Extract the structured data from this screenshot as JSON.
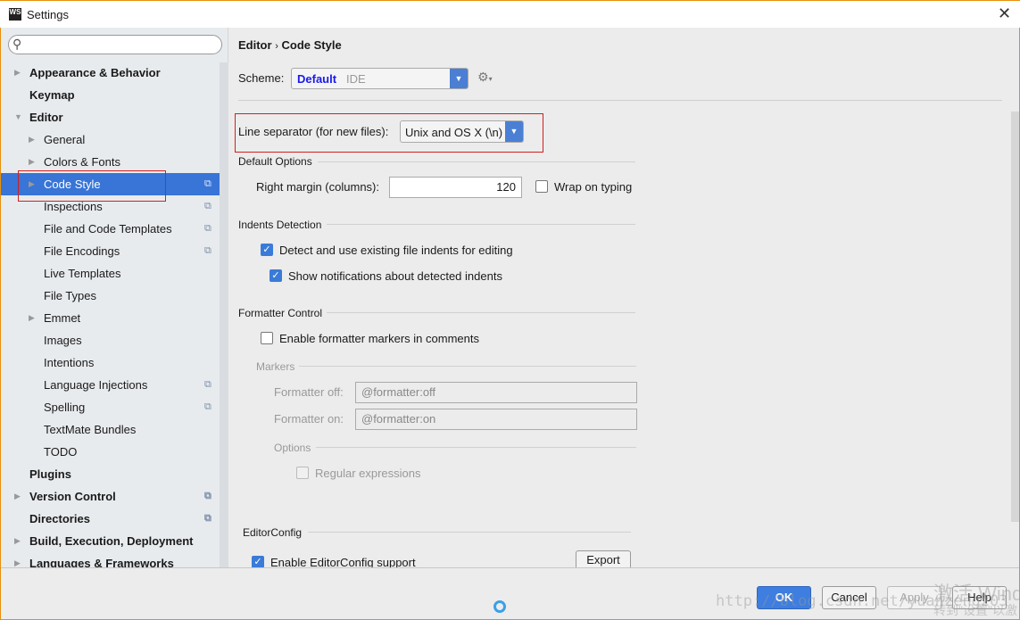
{
  "window": {
    "title": "Settings",
    "logo": "WS"
  },
  "search": {
    "placeholder": ""
  },
  "tree": [
    {
      "label": "Appearance & Behavior",
      "bold": true,
      "level": 0,
      "arrow": "right",
      "copy": false
    },
    {
      "label": "Keymap",
      "bold": true,
      "level": 0,
      "arrow": "",
      "copy": false
    },
    {
      "label": "Editor",
      "bold": true,
      "level": 0,
      "arrow": "down",
      "copy": false
    },
    {
      "label": "General",
      "bold": false,
      "level": 1,
      "arrow": "right",
      "copy": false
    },
    {
      "label": "Colors & Fonts",
      "bold": false,
      "level": 1,
      "arrow": "right",
      "copy": false
    },
    {
      "label": "Code Style",
      "bold": false,
      "level": 1,
      "arrow": "right",
      "copy": true,
      "selected": true
    },
    {
      "label": "Inspections",
      "bold": false,
      "level": 1,
      "arrow": "",
      "copy": true
    },
    {
      "label": "File and Code Templates",
      "bold": false,
      "level": 1,
      "arrow": "",
      "copy": true
    },
    {
      "label": "File Encodings",
      "bold": false,
      "level": 1,
      "arrow": "",
      "copy": true
    },
    {
      "label": "Live Templates",
      "bold": false,
      "level": 1,
      "arrow": "",
      "copy": false
    },
    {
      "label": "File Types",
      "bold": false,
      "level": 1,
      "arrow": "",
      "copy": false
    },
    {
      "label": "Emmet",
      "bold": false,
      "level": 1,
      "arrow": "right",
      "copy": false
    },
    {
      "label": "Images",
      "bold": false,
      "level": 1,
      "arrow": "",
      "copy": false
    },
    {
      "label": "Intentions",
      "bold": false,
      "level": 1,
      "arrow": "",
      "copy": false
    },
    {
      "label": "Language Injections",
      "bold": false,
      "level": 1,
      "arrow": "",
      "copy": true
    },
    {
      "label": "Spelling",
      "bold": false,
      "level": 1,
      "arrow": "",
      "copy": true
    },
    {
      "label": "TextMate Bundles",
      "bold": false,
      "level": 1,
      "arrow": "",
      "copy": false
    },
    {
      "label": "TODO",
      "bold": false,
      "level": 1,
      "arrow": "",
      "copy": false
    },
    {
      "label": "Plugins",
      "bold": true,
      "level": 0,
      "arrow": "",
      "copy": false
    },
    {
      "label": "Version Control",
      "bold": true,
      "level": 0,
      "arrow": "right",
      "copy": true
    },
    {
      "label": "Directories",
      "bold": true,
      "level": 0,
      "arrow": "",
      "copy": true
    },
    {
      "label": "Build, Execution, Deployment",
      "bold": true,
      "level": 0,
      "arrow": "right",
      "copy": false
    },
    {
      "label": "Languages & Frameworks",
      "bold": true,
      "level": 0,
      "arrow": "right",
      "copy": false
    }
  ],
  "breadcrumb": {
    "parent": "Editor",
    "sep": "›",
    "current": "Code Style"
  },
  "scheme": {
    "label": "Scheme:",
    "name": "Default",
    "kind": "IDE"
  },
  "line_separator": {
    "label": "Line separator (for new files):",
    "value": "Unix and OS X (\\n)"
  },
  "default_options": {
    "title": "Default Options",
    "right_margin_label": "Right margin (columns):",
    "right_margin_value": "120",
    "wrap_label": "Wrap on typing",
    "wrap_checked": false
  },
  "indents": {
    "title": "Indents Detection",
    "detect_label": "Detect and use existing file indents for editing",
    "detect_checked": true,
    "notify_label": "Show notifications about detected indents",
    "notify_checked": true
  },
  "formatter": {
    "title": "Formatter Control",
    "enable_label": "Enable formatter markers in comments",
    "enable_checked": false,
    "markers_title": "Markers",
    "off_label": "Formatter off:",
    "off_value": "@formatter:off",
    "on_label": "Formatter on:",
    "on_value": "@formatter:on",
    "options_title": "Options",
    "regex_label": "Regular expressions",
    "regex_checked": false
  },
  "editorconfig": {
    "title": "EditorConfig",
    "enable_label": "Enable EditorConfig support",
    "enable_checked": true,
    "export_label": "Export"
  },
  "footer": {
    "ok": "OK",
    "cancel": "Cancel",
    "apply": "Apply",
    "help": "Help"
  },
  "watermark": {
    "url": "http://blog.csdn.net/yuanzeng203",
    "activate1": "激活 Wind",
    "activate2": "转到\"设置\"以激"
  },
  "colors": {
    "accent": "#3875d7",
    "highlight_box": "#d02020",
    "window_border": "#e8900c"
  }
}
